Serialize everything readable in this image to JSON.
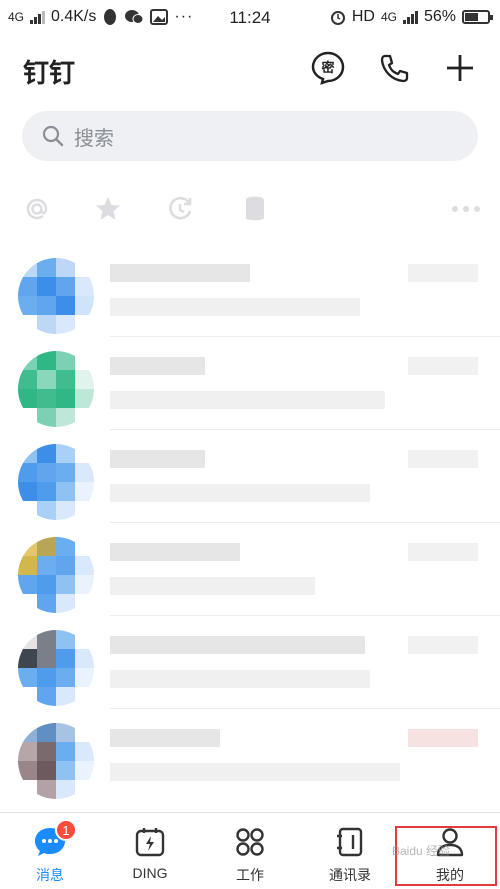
{
  "status_bar": {
    "network": "4G",
    "speed": "0.4K/s",
    "time": "11:24",
    "hd": "HD",
    "network2": "4G",
    "battery": "56%"
  },
  "header": {
    "title": "钉钉",
    "secret_chat_glyph": "密"
  },
  "search": {
    "placeholder": "搜索"
  },
  "quick_filters": [
    "at-icon",
    "star-icon",
    "history-icon",
    "cylinder-icon",
    "more-icon"
  ],
  "conversations": [
    {
      "avatar_colors": [
        "#bcd8f6",
        "#6aaef0",
        "#bcd8f6",
        "#ffffff",
        "#5fa6ef",
        "#3d8ee8",
        "#5fa6ef",
        "#d9e9fb",
        "#6aaef0",
        "#5fa6ef",
        "#3d8ee8",
        "#cfe3f9",
        "#ffffff",
        "#bcd8f6",
        "#d9e9fb",
        "#ffffff"
      ]
    },
    {
      "avatar_colors": [
        "#7cd1b4",
        "#2fb885",
        "#7cd1b4",
        "#ffffff",
        "#3fbd8e",
        "#8ad8bb",
        "#3fbd8e",
        "#e0f3ec",
        "#2fb885",
        "#3fbd8e",
        "#2fb885",
        "#bfe7d8",
        "#ffffff",
        "#7cd1b4",
        "#bfe7d8",
        "#ffffff"
      ]
    },
    {
      "avatar_colors": [
        "#8ec2f3",
        "#3d8ee8",
        "#a9d0f6",
        "#ffffff",
        "#4f9bec",
        "#5fa6ef",
        "#6aaef0",
        "#d9e9fb",
        "#3d8ee8",
        "#4f9bec",
        "#8ec2f3",
        "#eaf3fd",
        "#ffffff",
        "#a9d0f6",
        "#d9e9fb",
        "#ffffff"
      ]
    },
    {
      "avatar_colors": [
        "#e3c76a",
        "#b9a556",
        "#6aaef0",
        "#ffffff",
        "#d4b74c",
        "#6aaef0",
        "#5fa6ef",
        "#d9e9fb",
        "#5fa6ef",
        "#4f9bec",
        "#8ec2f3",
        "#eaf3fd",
        "#ffffff",
        "#5fa6ef",
        "#d9e9fb",
        "#ffffff"
      ]
    },
    {
      "avatar_colors": [
        "#e6e3e6",
        "#7a7f88",
        "#8ec2f3",
        "#ffffff",
        "#3e4650",
        "#7a7f88",
        "#4f9bec",
        "#d9e9fb",
        "#6aaef0",
        "#4f9bec",
        "#6aaef0",
        "#eaf3fd",
        "#ffffff",
        "#5fa6ef",
        "#d9e9fb",
        "#ffffff"
      ]
    },
    {
      "avatar_colors": [
        "#8fb0d6",
        "#5f8fc3",
        "#a7c3e3",
        "#ffffff",
        "#b7a6a8",
        "#7a6a6e",
        "#6aaef0",
        "#d9e9fb",
        "#9a8589",
        "#6c5a5f",
        "#8ec2f3",
        "#eaf3fd",
        "#ffffff",
        "#b2a2a6",
        "#d9e9fb",
        "#ffffff"
      ]
    }
  ],
  "bottom_nav": [
    {
      "label": "消息",
      "icon": "chat-bubble-icon",
      "badge": "1",
      "active": true
    },
    {
      "label": "DING",
      "icon": "ding-bolt-icon",
      "active": false
    },
    {
      "label": "工作",
      "icon": "work-grid-icon",
      "active": false
    },
    {
      "label": "通讯录",
      "icon": "contacts-book-icon",
      "active": false
    },
    {
      "label": "我的",
      "icon": "profile-person-icon",
      "active": false
    }
  ],
  "watermark": "Baidu 经验",
  "colors": {
    "accent": "#1a8cff",
    "badge": "#ff4a3d",
    "highlight_box": "#e23b3b"
  }
}
